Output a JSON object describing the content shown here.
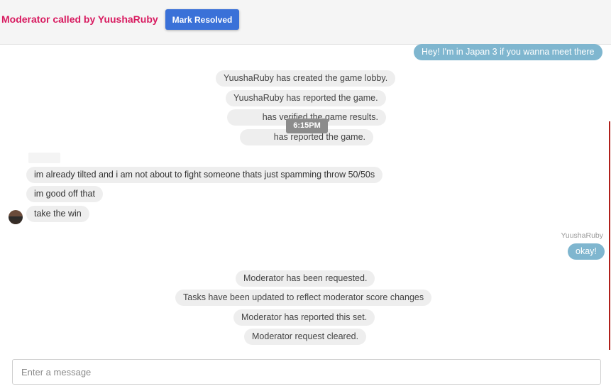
{
  "header": {
    "title": "Moderator called by YuushaRuby",
    "resolve_label": "Mark Resolved"
  },
  "messages": {
    "outgoing_top": "Hey! I'm in Japan 3 if you wanna meet there",
    "system_lobby": "YuushaRuby has created the game lobby.",
    "system_reported": "YuushaRuby has reported the game.",
    "system_verified": "has verified the game results.",
    "system_reported2": "has reported the game.",
    "timestamp": "6:15PM",
    "incoming_1": "im already tilted and i am not about to fight someone thats just spamming throw 50/50s",
    "incoming_2": "im good off that",
    "incoming_3": "take the win",
    "sender_name": "YuushaRuby",
    "outgoing_okay": "okay!",
    "system_mod_requested": "Moderator has been requested.",
    "system_tasks_updated": "Tasks have been updated to reflect moderator score changes",
    "system_mod_reported": "Moderator has reported this set.",
    "system_mod_cleared": "Moderator request cleared."
  },
  "composer": {
    "placeholder": "Enter a message"
  },
  "colors": {
    "title": "#d81b60",
    "button": "#3a71d8",
    "outgoing_bubble": "#7fb6cf",
    "system_bubble": "#eeeeee"
  }
}
